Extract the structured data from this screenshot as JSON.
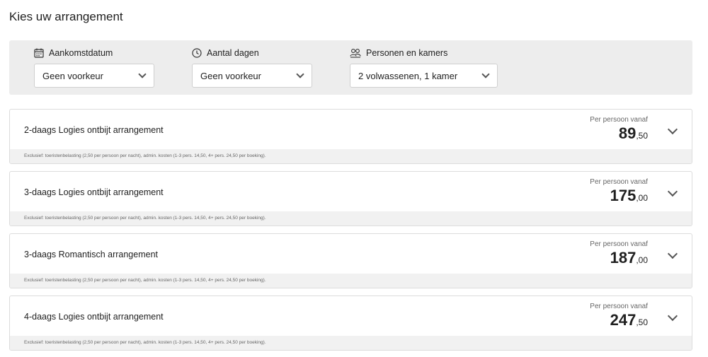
{
  "page": {
    "title": "Kies uw arrangement"
  },
  "filters": {
    "arrival": {
      "label": "Aankomstdatum",
      "value": "Geen voorkeur",
      "icon": "calendar-icon"
    },
    "days": {
      "label": "Aantal dagen",
      "value": "Geen voorkeur",
      "icon": "clock-icon"
    },
    "persons": {
      "label": "Personen en kamers",
      "value": "2 volwassenen, 1 kamer",
      "icon": "persons-icon"
    }
  },
  "packages": [
    {
      "name": "2-daags Logies ontbijt arrangement",
      "price_caption": "Per persoon vanaf",
      "price_whole": "89",
      "price_cents": ",50",
      "note": "Exclusief: toeristenbelasting (2,50 per persoon per nacht), admin. kosten (1-3 pers. 14,50, 4+ pers. 24,50 per boeking)."
    },
    {
      "name": "3-daags Logies ontbijt arrangement",
      "price_caption": "Per persoon vanaf",
      "price_whole": "175",
      "price_cents": ",00",
      "note": "Exclusief: toeristenbelasting (2,50 per persoon per nacht), admin. kosten (1-3 pers. 14,50, 4+ pers. 24,50 per boeking)."
    },
    {
      "name": "3-daags Romantisch arrangement",
      "price_caption": "Per persoon vanaf",
      "price_whole": "187",
      "price_cents": ",00",
      "note": "Exclusief: toeristenbelasting (2,50 per persoon per nacht), admin. kosten (1-3 pers. 14,50, 4+ pers. 24,50 per boeking)."
    },
    {
      "name": "4-daags Logies ontbijt arrangement",
      "price_caption": "Per persoon vanaf",
      "price_whole": "247",
      "price_cents": ",50",
      "note": "Exclusief: toeristenbelasting (2,50 per persoon per nacht), admin. kosten (1-3 pers. 14,50, 4+ pers. 24,50 per boeking)."
    }
  ]
}
